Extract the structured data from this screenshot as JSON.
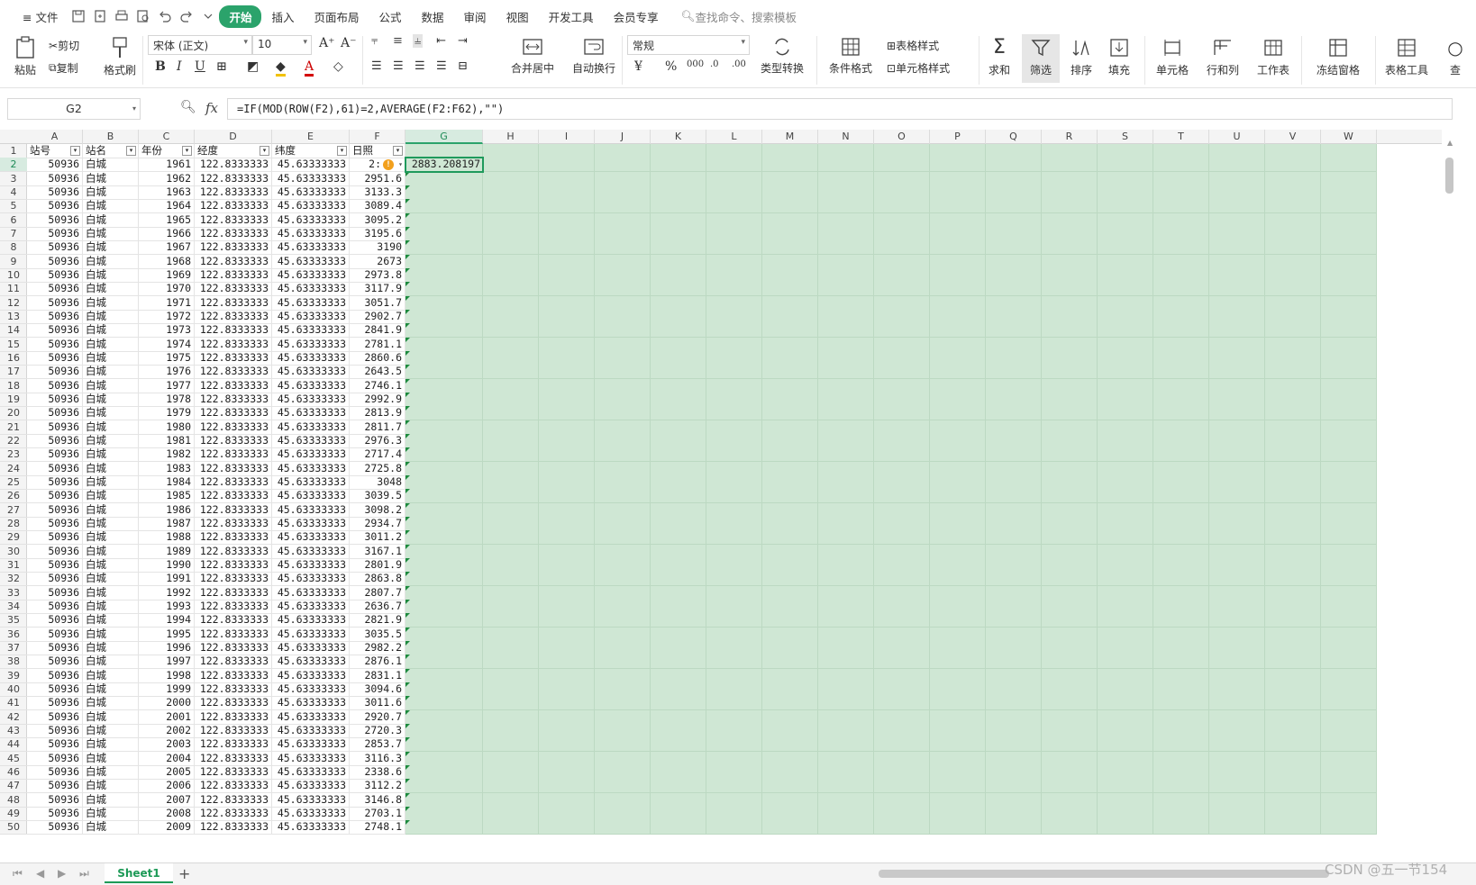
{
  "menubar": {
    "file": "文件",
    "tabs": [
      "开始",
      "插入",
      "页面布局",
      "公式",
      "数据",
      "审阅",
      "视图",
      "开发工具",
      "会员专享"
    ],
    "search": "查找命令、搜索模板"
  },
  "ribbon": {
    "paste": "粘贴",
    "cut": "剪切",
    "copy": "复制",
    "format_painter": "格式刷",
    "font_name": "宋体 (正文)",
    "font_size": "10",
    "merge_center": "合并居中",
    "wrap_text": "自动换行",
    "number_format": "常规",
    "type_convert": "类型转换",
    "cond_format": "条件格式",
    "table_style": "表格样式",
    "cell_style": "单元格样式",
    "sum": "求和",
    "filter": "筛选",
    "sort": "排序",
    "fill": "填充",
    "cells": "单元格",
    "row_col": "行和列",
    "worksheet": "工作表",
    "freeze": "冻结窗格",
    "table_tools": "表格工具",
    "find": "查"
  },
  "formula_bar": {
    "name_box": "G2",
    "fx": "fx",
    "formula": "=IF(MOD(ROW(F2),61)=2,AVERAGE(F2:F62),\"\")"
  },
  "grid": {
    "columns": [
      "A",
      "B",
      "C",
      "D",
      "E",
      "F",
      "G",
      "H",
      "I",
      "J",
      "K",
      "L",
      "M",
      "N",
      "O",
      "P",
      "Q",
      "R",
      "S",
      "T",
      "U",
      "V",
      "W"
    ],
    "selected_column": "G",
    "headers": [
      "站号",
      "站名",
      "年份",
      "经度",
      "纬度",
      "日照"
    ],
    "station_id": "50936",
    "station_name": "白城",
    "lon": "122.8333333",
    "lat": "45.63333333",
    "rows": [
      [
        "2",
        "1961",
        "2:"
      ],
      [
        "3",
        "1962",
        "2951.6"
      ],
      [
        "4",
        "1963",
        "3133.3"
      ],
      [
        "5",
        "1964",
        "3089.4"
      ],
      [
        "6",
        "1965",
        "3095.2"
      ],
      [
        "7",
        "1966",
        "3195.6"
      ],
      [
        "8",
        "1967",
        "3190"
      ],
      [
        "9",
        "1968",
        "2673"
      ],
      [
        "10",
        "1969",
        "2973.8"
      ],
      [
        "11",
        "1970",
        "3117.9"
      ],
      [
        "12",
        "1971",
        "3051.7"
      ],
      [
        "13",
        "1972",
        "2902.7"
      ],
      [
        "14",
        "1973",
        "2841.9"
      ],
      [
        "15",
        "1974",
        "2781.1"
      ],
      [
        "16",
        "1975",
        "2860.6"
      ],
      [
        "17",
        "1976",
        "2643.5"
      ],
      [
        "18",
        "1977",
        "2746.1"
      ],
      [
        "19",
        "1978",
        "2992.9"
      ],
      [
        "20",
        "1979",
        "2813.9"
      ],
      [
        "21",
        "1980",
        "2811.7"
      ],
      [
        "22",
        "1981",
        "2976.3"
      ],
      [
        "23",
        "1982",
        "2717.4"
      ],
      [
        "24",
        "1983",
        "2725.8"
      ],
      [
        "25",
        "1984",
        "3048"
      ],
      [
        "26",
        "1985",
        "3039.5"
      ],
      [
        "27",
        "1986",
        "3098.2"
      ],
      [
        "28",
        "1987",
        "2934.7"
      ],
      [
        "29",
        "1988",
        "3011.2"
      ],
      [
        "30",
        "1989",
        "3167.1"
      ],
      [
        "31",
        "1990",
        "2801.9"
      ],
      [
        "32",
        "1991",
        "2863.8"
      ],
      [
        "33",
        "1992",
        "2807.7"
      ],
      [
        "34",
        "1993",
        "2636.7"
      ],
      [
        "35",
        "1994",
        "2821.9"
      ],
      [
        "36",
        "1995",
        "3035.5"
      ],
      [
        "37",
        "1996",
        "2982.2"
      ],
      [
        "38",
        "1997",
        "2876.1"
      ],
      [
        "39",
        "1998",
        "2831.1"
      ],
      [
        "40",
        "1999",
        "3094.6"
      ],
      [
        "41",
        "2000",
        "3011.6"
      ],
      [
        "42",
        "2001",
        "2920.7"
      ],
      [
        "43",
        "2002",
        "2720.3"
      ],
      [
        "44",
        "2003",
        "2853.7"
      ],
      [
        "45",
        "2004",
        "3116.3"
      ],
      [
        "46",
        "2005",
        "2338.6"
      ],
      [
        "47",
        "2006",
        "3112.2"
      ],
      [
        "48",
        "2007",
        "3146.8"
      ],
      [
        "49",
        "2008",
        "2703.1"
      ],
      [
        "50",
        "2009",
        "2748.1"
      ]
    ],
    "g2_value": "2883.208197"
  },
  "sheetbar": {
    "tab": "Sheet1",
    "add": "+"
  },
  "watermark": "CSDN @五一节154"
}
